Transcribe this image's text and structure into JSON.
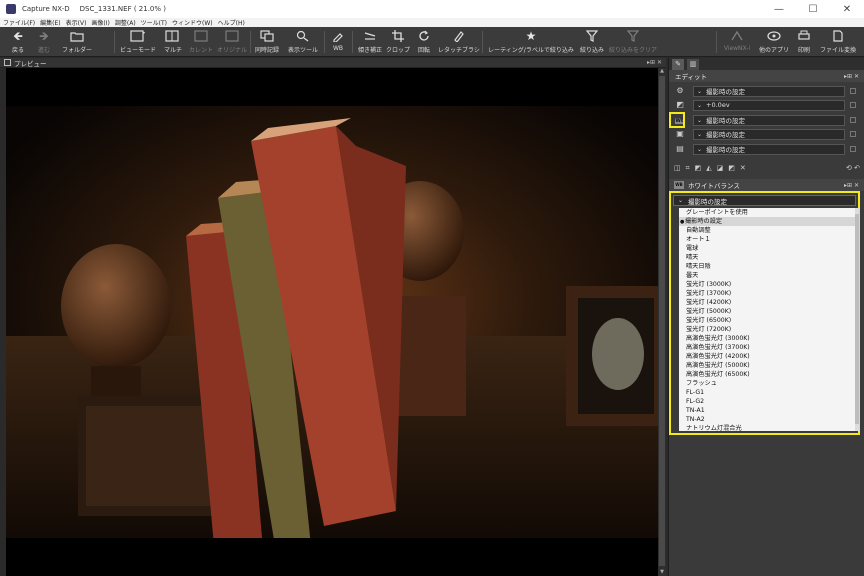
{
  "titlebar": {
    "app": "Capture NX-D",
    "file": "DSC_1331.NEF ( 21.0% )",
    "buttons": [
      "—",
      "☐",
      "✕"
    ]
  },
  "menu": [
    "ファイル(F)",
    "編集(E)",
    "表示(V)",
    "画像(I)",
    "調整(A)",
    "ツール(T)",
    "ウィンドウ(W)",
    "ヘルプ(H)"
  ],
  "toolbar": {
    "back": {
      "label": "戻る",
      "icon": "arrow-left-icon"
    },
    "forward": {
      "label": "進む",
      "icon": "arrow-right-icon"
    },
    "folder": {
      "label": "フォルダー",
      "icon": "folder-icon"
    },
    "view_mode": {
      "label": "ビューモード",
      "icon": "view-mode-icon"
    },
    "multi": {
      "label": "マルチ",
      "icon": "multi-icon"
    },
    "current": {
      "label": "カレント",
      "icon": "current-icon"
    },
    "original": {
      "label": "オリジナル",
      "icon": "original-icon"
    },
    "sync": {
      "label": "同時記録",
      "icon": "sync-icon"
    },
    "display_tool": {
      "label": "表示ツール",
      "icon": "display-tool-icon"
    },
    "wb": {
      "label": "WB",
      "icon": "wb-eyedropper-icon"
    },
    "straighten": {
      "label": "傾き補正",
      "icon": "straighten-icon"
    },
    "crop": {
      "label": "クロップ",
      "icon": "crop-icon"
    },
    "rotate": {
      "label": "回転",
      "icon": "rotate-icon"
    },
    "retouch": {
      "label": "レタッチブラシ",
      "icon": "retouch-brush-icon"
    },
    "rating_filter": {
      "label": "レーティング/ラベルで絞り込み",
      "icon": "star-icon"
    },
    "filter": {
      "label": "絞り込み",
      "icon": "filter-icon"
    },
    "filter_clear": {
      "label": "絞り込みをクリア",
      "icon": "filter-clear-icon"
    },
    "viewnx": {
      "label": "ViewNX-i",
      "icon": "viewnx-icon"
    },
    "other_apps": {
      "label": "他のアプリ",
      "icon": "other-apps-icon"
    },
    "print": {
      "label": "印刷",
      "icon": "print-icon"
    },
    "convert": {
      "label": "ファイル変換",
      "icon": "file-convert-icon"
    }
  },
  "preview": {
    "title": "プレビュー"
  },
  "right_panel": {
    "edit_title": "エディット",
    "edit_rows": [
      {
        "icon": "gear-icon",
        "value": "撮影時の設定"
      },
      {
        "icon": "exposure-icon",
        "value": "+0.0ev"
      },
      {
        "icon": "wb-icon",
        "value": "撮影時の設定"
      },
      {
        "icon": "picture-control-icon",
        "value": "撮影時の設定"
      },
      {
        "icon": "camera-settings-icon",
        "value": "撮影時の設定"
      }
    ],
    "wb_panel_title": "ホワイトバランス",
    "wb_selected": "撮影時の設定",
    "wb_options": [
      "グレーポイントを使用",
      "撮影時の設定",
      "自動調整",
      "オート１",
      "電球",
      "晴天",
      "晴天日陰",
      "曇天",
      "蛍光灯 (3000K)",
      "蛍光灯 (3700K)",
      "蛍光灯 (4200K)",
      "蛍光灯 (5000K)",
      "蛍光灯 (6500K)",
      "蛍光灯 (7200K)",
      "高演色蛍光灯 (3000K)",
      "高演色蛍光灯 (3700K)",
      "高演色蛍光灯 (4200K)",
      "高演色蛍光灯 (5000K)",
      "高演色蛍光灯 (6500K)",
      "フラッシュ",
      "FL-G1",
      "FL-G2",
      "TN-A1",
      "TN-A2",
      "ナトリウム灯混合光"
    ]
  },
  "colors": {
    "highlight": "#f2ea1a",
    "panel": "#3a3a3a",
    "toolbar": "#3b3b3b"
  }
}
